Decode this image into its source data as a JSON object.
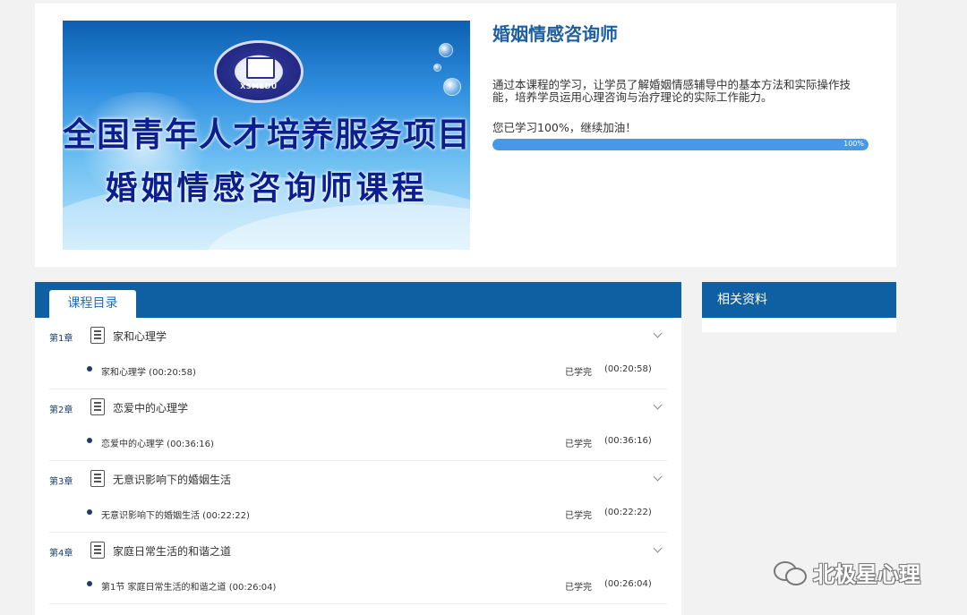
{
  "course": {
    "banner": {
      "logo_text": "XSMEDU",
      "line1": "全国青年人才培养服务项目",
      "line2": "婚姻情感咨询师课程"
    },
    "title": "婚姻情感咨询师",
    "description": "通过本课程的学习，让学员了解婚姻情感辅导中的基本方法和实际操作技能，培养学员运用心理咨询与治疗理论的实际工作能力。",
    "progress_text": "您已学习100%，继续加油！",
    "progress_value": 100,
    "progress_label": "100%"
  },
  "catalog": {
    "tab_label": "课程目录",
    "chapters": [
      {
        "num": "第1章",
        "title": "家和心理学",
        "lesson": "家和心理学 (00:20:58)",
        "status": "已学完",
        "duration": "(00:20:58)"
      },
      {
        "num": "第2章",
        "title": "恋爱中的心理学",
        "lesson": "恋爱中的心理学 (00:36:16)",
        "status": "已学完",
        "duration": "(00:36:16)"
      },
      {
        "num": "第3章",
        "title": "无意识影响下的婚姻生活",
        "lesson": "无意识影响下的婚姻生活 (00:22:22)",
        "status": "已学完",
        "duration": "(00:22:22)"
      },
      {
        "num": "第4章",
        "title": "家庭日常生活的和谐之道",
        "lesson": "第1节 家庭日常生活的和谐之道 (00:26:04)",
        "status": "已学完",
        "duration": "(00:26:04)"
      }
    ]
  },
  "related": {
    "title": "相关资料"
  },
  "watermark": {
    "icon": "wechat-icon",
    "text": "北极星心理"
  },
  "colors": {
    "header_blue": "#0f5fa3",
    "progress_blue": "#4799e8",
    "title_blue": "#1e5fa0"
  }
}
